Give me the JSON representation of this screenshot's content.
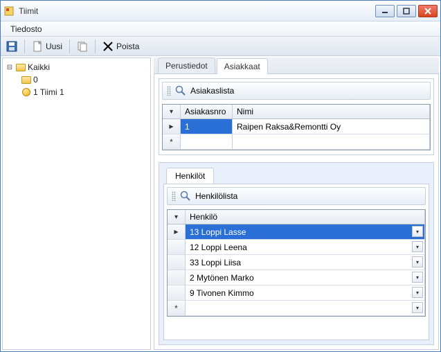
{
  "window": {
    "title": "Tiimit"
  },
  "menu": {
    "file": "Tiedosto"
  },
  "toolbar": {
    "new": "Uusi",
    "delete": "Poista"
  },
  "tree": {
    "root": "Kaikki",
    "items": [
      {
        "label": "0"
      },
      {
        "label": "1 Tiimi 1"
      }
    ]
  },
  "tabs": {
    "basic": "Perustiedot",
    "customers": "Asiakkaat"
  },
  "customers": {
    "sectionTitle": "Asiakaslista",
    "columns": {
      "nro": "Asiakasnro",
      "nimi": "Nimi"
    },
    "rows": [
      {
        "nro": "1",
        "nimi": "Raipen Raksa&Remontti Oy"
      }
    ]
  },
  "people": {
    "tab": "Henkilöt",
    "sectionTitle": "Henkilölista",
    "columns": {
      "henkilo": "Henkilö"
    },
    "rows": [
      {
        "label": "13 Loppi Lasse"
      },
      {
        "label": "12 Loppi Leena"
      },
      {
        "label": "33 Loppi Liisa"
      },
      {
        "label": "2 Mytönen Marko"
      },
      {
        "label": "9 Tivonen Kimmo"
      }
    ]
  }
}
